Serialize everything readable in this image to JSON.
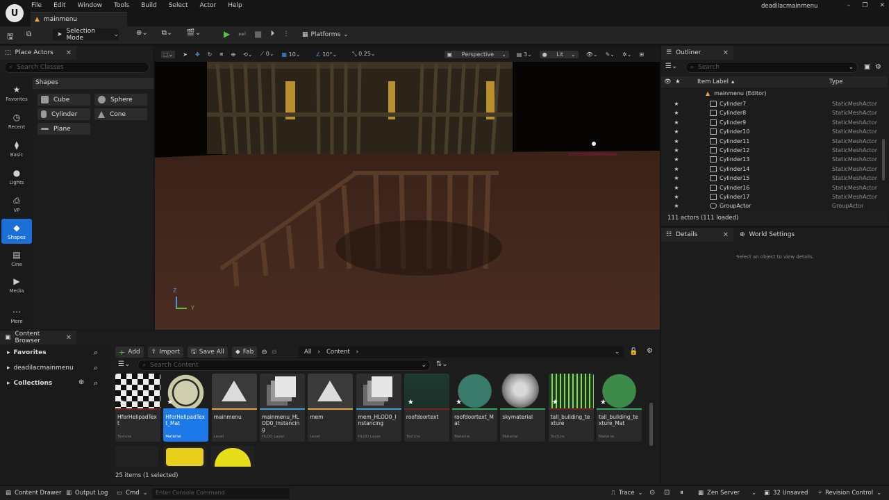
{
  "menu": {
    "items": [
      "File",
      "Edit",
      "Window",
      "Tools",
      "Build",
      "Select",
      "Actor",
      "Help"
    ]
  },
  "doc_tab": {
    "label": "mainmenu"
  },
  "window": {
    "project": "deadilacmainmenu"
  },
  "toolbar": {
    "selection_mode": "Selection Mode",
    "platforms": "Platforms"
  },
  "place_actors": {
    "tab": "Place Actors",
    "search_placeholder": "Search Classes",
    "section": "Shapes",
    "categories": [
      "Favorites",
      "Recent",
      "Basic",
      "Lights",
      "VP",
      "Shapes",
      "Cine",
      "Media",
      "More"
    ],
    "shapes": [
      "Cube",
      "Sphere",
      "Cylinder",
      "Cone",
      "Plane"
    ]
  },
  "viewport": {
    "snap_angle": "0",
    "grid": "10",
    "rotation": "10°",
    "scale": "0.25",
    "view": "Perspective",
    "fov": "3",
    "lit": "Lit",
    "axis_z": "Z",
    "axis_y": "Y"
  },
  "outliner": {
    "tab": "Outliner",
    "search_placeholder": "Search",
    "col_label": "Item Label",
    "col_type": "Type",
    "root": "mainmenu (Editor)",
    "rows": [
      {
        "label": "Cylinder7",
        "type": "StaticMeshActor"
      },
      {
        "label": "Cylinder8",
        "type": "StaticMeshActor"
      },
      {
        "label": "Cylinder9",
        "type": "StaticMeshActor"
      },
      {
        "label": "Cylinder10",
        "type": "StaticMeshActor"
      },
      {
        "label": "Cylinder11",
        "type": "StaticMeshActor"
      },
      {
        "label": "Cylinder12",
        "type": "StaticMeshActor"
      },
      {
        "label": "Cylinder13",
        "type": "StaticMeshActor"
      },
      {
        "label": "Cylinder14",
        "type": "StaticMeshActor"
      },
      {
        "label": "Cylinder15",
        "type": "StaticMeshActor"
      },
      {
        "label": "Cylinder16",
        "type": "StaticMeshActor"
      },
      {
        "label": "Cylinder17",
        "type": "StaticMeshActor"
      },
      {
        "label": "GroupActor",
        "type": "GroupActor"
      }
    ],
    "count": "111 actors (111 loaded)"
  },
  "details": {
    "tab": "Details",
    "world_settings": "World Settings",
    "empty": "Select an object to view details."
  },
  "content_browser": {
    "tab": "Content Browser",
    "favorites": "Favorites",
    "project": "deadilacmainmenu",
    "collections": "Collections",
    "add": "Add",
    "import": "Import",
    "save_all": "Save All",
    "fab": "Fab",
    "crumb_all": "All",
    "crumb_content": "Content",
    "search_placeholder": "Search Content",
    "assets": [
      {
        "name": "HforHelipadText",
        "type": "Texture"
      },
      {
        "name": "HforHelipadText_Mat",
        "type": "Material"
      },
      {
        "name": "mainmenu",
        "type": "Level"
      },
      {
        "name": "mainmenu_HLOD0_Instancing",
        "type": "HLOD Layer"
      },
      {
        "name": "mem",
        "type": "Level"
      },
      {
        "name": "mem_HLOD0_Instancing",
        "type": "HLOD Layer"
      },
      {
        "name": "roofdoortext",
        "type": "Texture"
      },
      {
        "name": "roofdoortext_Mat",
        "type": "Material"
      },
      {
        "name": "skymaterial",
        "type": "Material"
      },
      {
        "name": "tall_building_texture",
        "type": "Texture"
      },
      {
        "name": "tall_building_texture_Mat",
        "type": "Material"
      }
    ],
    "item_count": "25 items (1 selected)"
  },
  "status": {
    "content_drawer": "Content Drawer",
    "output_log": "Output Log",
    "cmd": "Cmd",
    "console_placeholder": "Enter Console Command",
    "trace": "Trace",
    "zen": "Zen Server",
    "unsaved": "32 Unsaved",
    "revision": "Revision Control"
  },
  "colors": {
    "accent": "#1d6fd8",
    "play": "#5cbf45",
    "panel": "#1c1c1c"
  }
}
